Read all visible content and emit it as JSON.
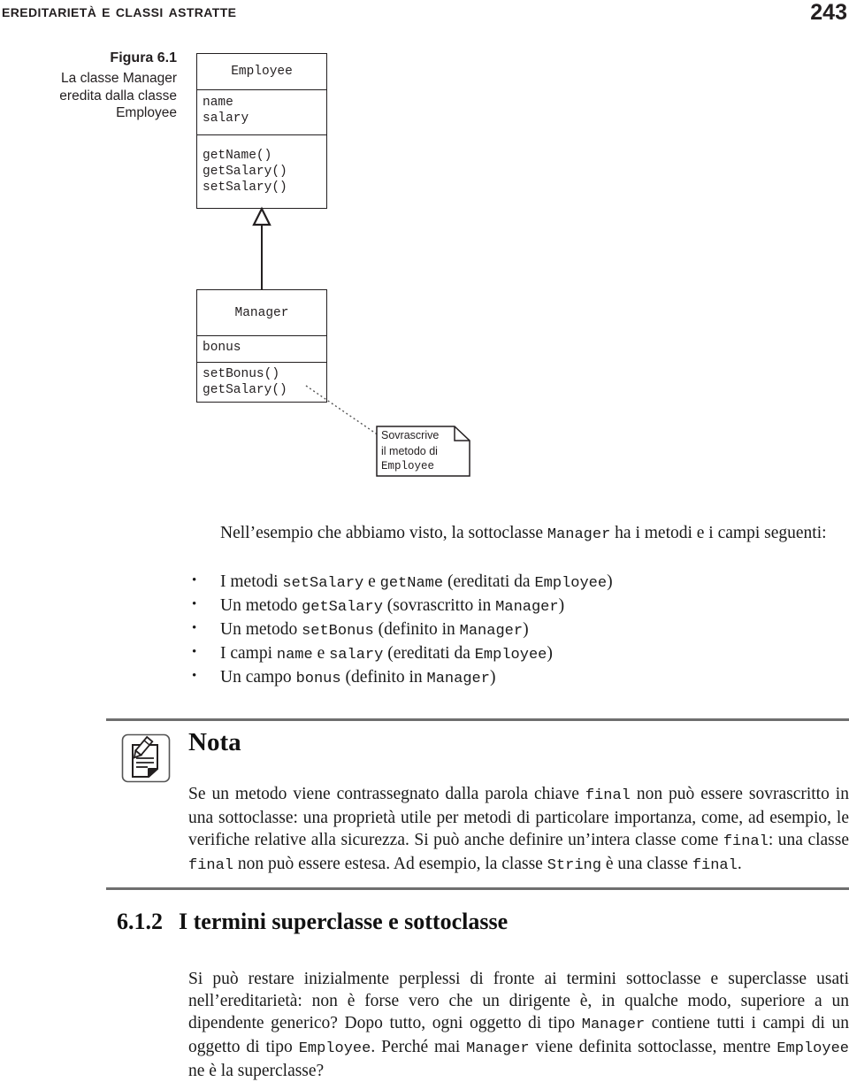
{
  "header": {
    "title": "Ereditarietà e classi astratte",
    "page_number": "243"
  },
  "figure": {
    "caption_number": "Figura 6.1",
    "caption_lines": [
      "La classe Manager",
      "eredita dalla classe",
      "Employee"
    ],
    "employee_class": {
      "name": "Employee",
      "fields": "name\nsalary",
      "methods": "getName()\ngetSalary()\nsetSalary()"
    },
    "manager_class": {
      "name": "Manager",
      "fields": "bonus",
      "methods": "setBonus()\ngetSalary()"
    },
    "note": {
      "line1": "Sovrascrive",
      "line2": "il metodo di",
      "line3": "Employee"
    },
    "relationship": "generalization-inheritance-arrow"
  },
  "intro": {
    "text_1": "Nell’esempio che abbiamo visto, la sottoclasse ",
    "code_1": "Manager",
    "text_2": " ha i metodi e i campi seguenti:"
  },
  "bullets": [
    {
      "t1": "I metodi ",
      "c1": "setSalary",
      "t2": " e ",
      "c2": "getName",
      "t3": " (ereditati da ",
      "c3": "Employee",
      "t4": ")"
    },
    {
      "t1": "Un metodo ",
      "c1": "getSalary",
      "t2": " (sovrascritto in ",
      "c2": "Manager",
      "t3": ")",
      "c3": "",
      "t4": ""
    },
    {
      "t1": "Un metodo ",
      "c1": "setBonus",
      "t2": " (definito in ",
      "c2": "Manager",
      "t3": ")",
      "c3": "",
      "t4": ""
    },
    {
      "t1": "I campi ",
      "c1": "name",
      "t2": " e ",
      "c2": "salary",
      "t3": " (ereditati da ",
      "c3": "Employee",
      "t4": ")"
    },
    {
      "t1": "Un campo ",
      "c1": "bonus",
      "t2": " (definito in ",
      "c2": "Manager",
      "t3": ")",
      "c3": "",
      "t4": ""
    }
  ],
  "nota": {
    "icon": "note-pencil-icon",
    "title": "Nota",
    "p1": "Se un metodo viene contrassegnato dalla parola chiave ",
    "c1": "final",
    "p2": " non può essere sovrascritto in una sottoclasse: una proprietà utile per metodi di particolare importanza, come, ad esempio, le verifiche relative alla sicurezza. Si può anche definire un’intera classe come ",
    "c2": "final",
    "p3": ": una classe ",
    "c3": "final",
    "p4": " non può essere estesa. Ad esempio, la classe ",
    "c4": "String",
    "p5": " è una classe ",
    "c5": "final",
    "p6": "."
  },
  "section": {
    "number": "6.1.2",
    "title": "I termini superclasse e sottoclasse",
    "p1": "Si può restare inizialmente perplessi di fronte ai termini sottoclasse e superclasse usati nell’ereditarietà: non è forse vero che un dirigente è, in qualche modo, superiore a un dipendente generico? Dopo tutto, ogni oggetto di tipo ",
    "c1": "Manager",
    "p2": " contiene tutti i campi di un oggetto di tipo ",
    "c2": "Employee",
    "p3": ". Perché mai ",
    "c3": "Manager",
    "p4": " viene definita sottoclasse, mentre ",
    "c4": "Employee",
    "p5": " ne è la superclasse?"
  },
  "colors": {
    "text": "#1a1a1a",
    "rule": "#6f6f6f",
    "diagram_stroke": "#231f20"
  }
}
